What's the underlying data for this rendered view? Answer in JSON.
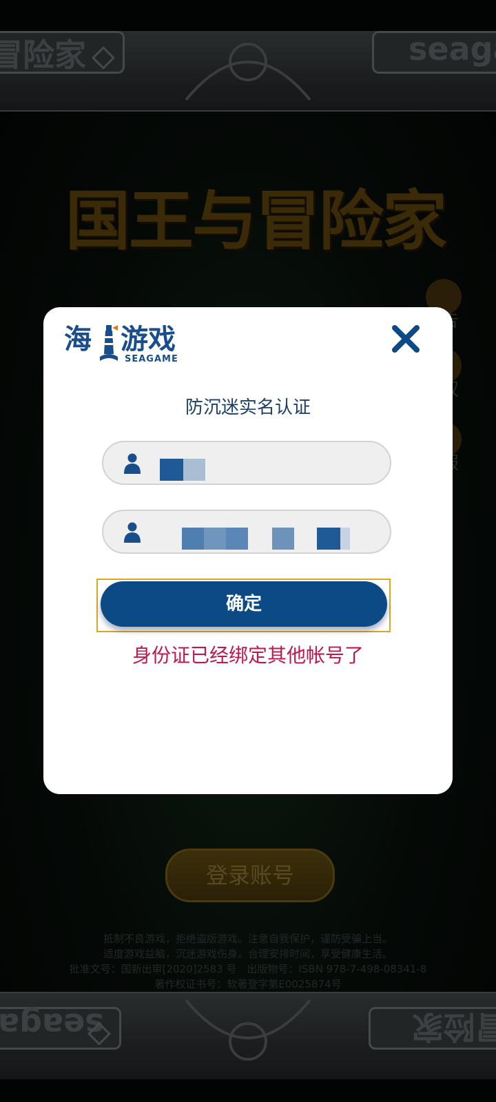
{
  "background": {
    "game_title": "国王与冒险家",
    "top_left_plate_text": "冒险家",
    "top_right_plate_text": "seaga",
    "bottom_left_plate_text": "seaga",
    "bottom_right_plate_text": "冒险家",
    "side_labels": [
      "告",
      "权",
      "服"
    ],
    "login_button_label": "登录账号",
    "legal_lines": [
      "抵制不良游戏，拒绝盗版游戏。注意自我保护，谨防受骗上当。",
      "适度游戏益脑，沉迷游戏伤身。合理安排时间，享受健康生活。",
      "批准文号：国新出审[2020]2583 号　出版物号：ISBN 978-7-498-08341-8",
      "著作权证书号：软著登字第E0025874号"
    ]
  },
  "modal": {
    "logo": {
      "text_cn_left": "海",
      "text_cn_right": "游戏",
      "text_en": "SEAGAME",
      "icon": "lighthouse-icon"
    },
    "close_icon": "close-icon",
    "title": "防沉迷实名认证",
    "fields": [
      {
        "icon": "user-icon",
        "value": "",
        "placeholder": ""
      },
      {
        "icon": "user-icon",
        "value": "",
        "placeholder": ""
      }
    ],
    "confirm_label": "确定",
    "error_message": "身份证已经绑定其他帐号了"
  },
  "colors": {
    "brand_blue": "#0c4a86",
    "title_blue": "#1b3f6b",
    "error_red": "#c0184c",
    "focus_outline": "#e0a423"
  }
}
